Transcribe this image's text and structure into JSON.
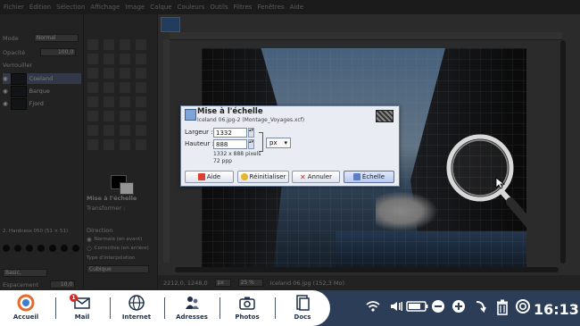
{
  "menu": [
    "Fichier",
    "Édition",
    "Sélection",
    "Affichage",
    "Image",
    "Calque",
    "Couleurs",
    "Outils",
    "Filtres",
    "Fenêtres",
    "Aide"
  ],
  "left_panel": {
    "mode_label": "Mode",
    "mode_value": "Normal",
    "opacity_label": "Opacité",
    "opacity_value": "100,0",
    "lock_label": "Verrouiller",
    "layers": [
      "Coeland",
      "Barque",
      "Fjord"
    ],
    "spacing_label": "Espacement",
    "spacing_value": "10,0",
    "brush_name": "2. Hardness 050 (51 × 51)",
    "basic_label": "Basic,"
  },
  "tool_options": {
    "title": "Mise à l'échelle",
    "transform_label": "Transformer :",
    "direction_label": "Direction",
    "direction_normal": "Normale (en avant)",
    "direction_corrective": "Corrective (en arrière)",
    "interpolation_label": "Type d'interpolation",
    "interpolation_value": "Cubique"
  },
  "status": {
    "coords": "2212,0, 1248,0",
    "unit": "px",
    "zoom": "25 %",
    "file": "Iceland 06.jpg (152,3 Mo)"
  },
  "dialog": {
    "title": "Mise à l'échelle",
    "subtitle": "Iceland 06.jpg-2 (Montage_Voyages.xcf)",
    "width_label": "Largeur :",
    "width_value": "1332",
    "height_label": "Hauteur :",
    "height_value": "888",
    "unit_value": "px",
    "size_info": "1332 x 888 pixels",
    "res_info": "72 ppp",
    "buttons": {
      "help": "Aide",
      "reset": "Réinitialiser",
      "cancel": "Annuler",
      "scale": "Échelle"
    }
  },
  "dock": [
    {
      "label": "Accueil",
      "icon": "home-icon"
    },
    {
      "label": "Mail",
      "icon": "mail-icon"
    },
    {
      "label": "Internet",
      "icon": "globe-icon"
    },
    {
      "label": "Adresses",
      "icon": "contacts-icon"
    },
    {
      "label": "Photos",
      "icon": "camera-icon"
    },
    {
      "label": "Docs",
      "icon": "docs-icon"
    }
  ],
  "mail_badge": "1",
  "tray_icons": [
    "wifi-icon",
    "volume-icon",
    "battery-icon",
    "zoom-out-icon",
    "zoom-in-icon",
    "back-icon",
    "trash-icon",
    "help-icon"
  ],
  "clock": "16:13",
  "colors": {
    "taskbar": "#2c3e57",
    "dock": "#ffffff",
    "dialog": "#e9ecf3",
    "accent": "#d9281e"
  }
}
